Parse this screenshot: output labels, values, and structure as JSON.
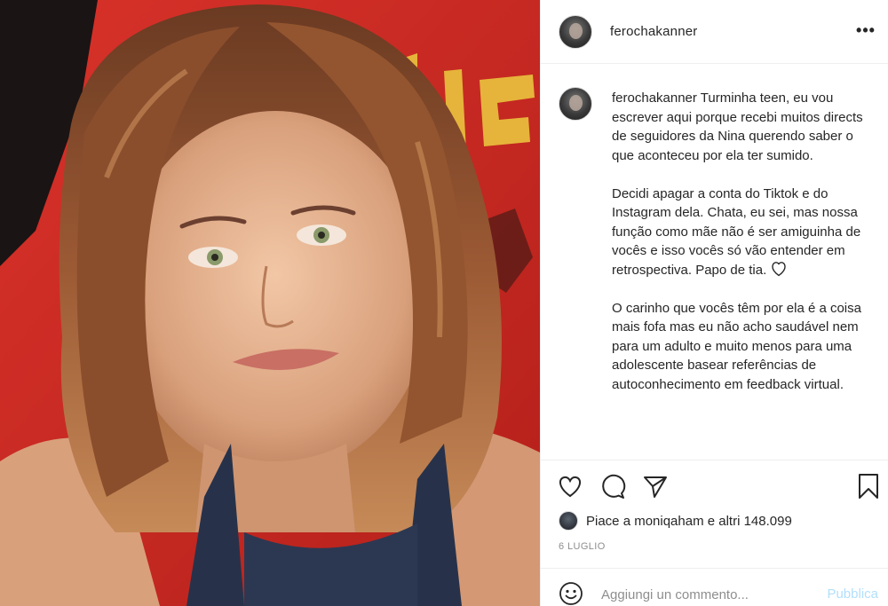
{
  "post": {
    "username": "ferochakanner",
    "more_label": "•••"
  },
  "caption": {
    "username": "ferochakanner",
    "paragraph1": " Turminha teen, eu vou escrever aqui porque recebi muitos directs de seguidores da Nina querendo saber o que aconteceu por ela ter sumido.",
    "paragraph2": "Decidi apagar a conta do Tiktok e do Instagram dela. Chata, eu sei, mas nossa função como mãe não é ser amiguinha de vocês e isso vocês só vão entender em retrospectiva. Papo de tia.",
    "paragraph3": "O carinho que vocês têm por ela é a coisa mais fofa mas eu não acho saudável nem para um adulto e muito menos para uma adolescente basear referências de autoconhecimento em feedback virtual."
  },
  "actions": {
    "like_icon": "heart-icon",
    "comment_icon": "comment-icon",
    "share_icon": "paper-plane-icon",
    "save_icon": "bookmark-icon"
  },
  "likes": {
    "text": "Piace a moniqaham e altri 148.099"
  },
  "date": "6 LUGLIO",
  "comment": {
    "placeholder": "Aggiungi un commento...",
    "publish_label": "Pubblica"
  },
  "colors": {
    "text": "#262626",
    "secondary": "#8e8e8e",
    "border": "#efefef",
    "publish_disabled": "#b2dffc",
    "photo_background_red": "#c62a22"
  }
}
